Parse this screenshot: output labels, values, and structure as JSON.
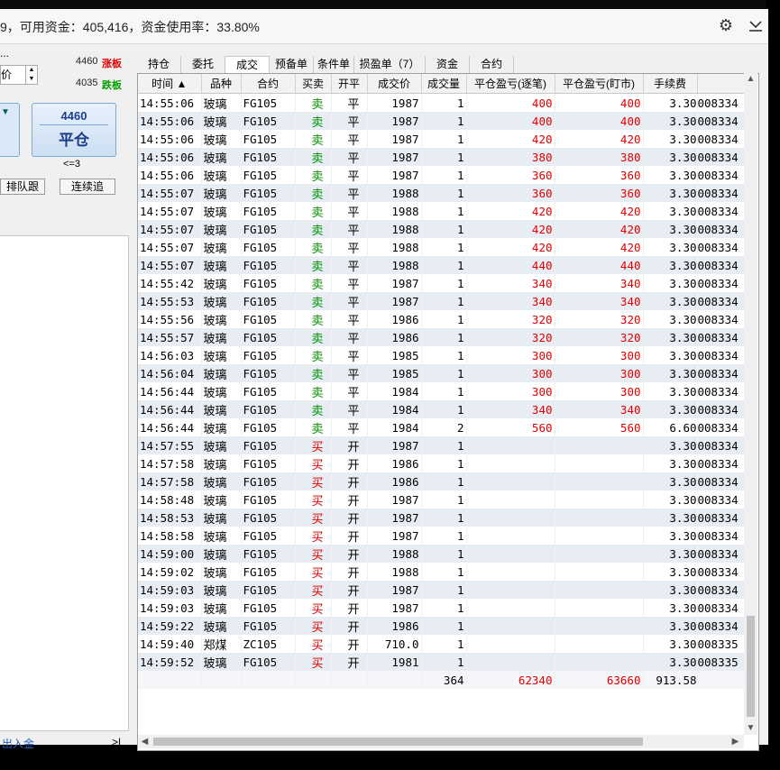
{
  "window": {
    "title": "9，可用资金：405,416，资金使用率：33.80%",
    "gear_icon": "gear-icon",
    "minimize_icon": "chevron-down-icon"
  },
  "left_panel": {
    "ellipsis": "...",
    "price_type": "价",
    "up_limit_price": "4460",
    "up_limit_label": "涨板",
    "down_limit_price": "4035",
    "down_limit_label": "跌板",
    "close_button_price": "4460",
    "close_button_label": "平仓",
    "condition": "<=3",
    "queue_button": "排队跟",
    "continue_button": "连续追",
    "deposit_link": "出入金",
    "expand_button": ">|"
  },
  "tabs": [
    {
      "label": "持仓"
    },
    {
      "label": "委托"
    },
    {
      "label": "成交"
    },
    {
      "label": "预备单"
    },
    {
      "label": "条件单"
    },
    {
      "label": "损盈单（7）"
    },
    {
      "label": "资金"
    },
    {
      "label": "合约"
    }
  ],
  "active_tab": "成交",
  "columns": [
    "时间 ▲",
    "品种",
    "合约",
    "买卖",
    "开平",
    "成交价",
    "成交量",
    "平仓盈亏(逐笔)",
    "平仓盈亏(盯市)",
    "手续费",
    ""
  ],
  "rows": [
    [
      "14:55:06",
      "玻璃",
      "FG105",
      "卖",
      "平",
      "1987",
      "1",
      "400",
      "400",
      "3.30",
      "008334"
    ],
    [
      "14:55:06",
      "玻璃",
      "FG105",
      "卖",
      "平",
      "1987",
      "1",
      "400",
      "400",
      "3.30",
      "008334"
    ],
    [
      "14:55:06",
      "玻璃",
      "FG105",
      "卖",
      "平",
      "1987",
      "1",
      "420",
      "420",
      "3.30",
      "008334"
    ],
    [
      "14:55:06",
      "玻璃",
      "FG105",
      "卖",
      "平",
      "1987",
      "1",
      "380",
      "380",
      "3.30",
      "008334"
    ],
    [
      "14:55:06",
      "玻璃",
      "FG105",
      "卖",
      "平",
      "1987",
      "1",
      "360",
      "360",
      "3.30",
      "008334"
    ],
    [
      "14:55:07",
      "玻璃",
      "FG105",
      "卖",
      "平",
      "1988",
      "1",
      "360",
      "360",
      "3.30",
      "008334"
    ],
    [
      "14:55:07",
      "玻璃",
      "FG105",
      "卖",
      "平",
      "1988",
      "1",
      "420",
      "420",
      "3.30",
      "008334"
    ],
    [
      "14:55:07",
      "玻璃",
      "FG105",
      "卖",
      "平",
      "1988",
      "1",
      "420",
      "420",
      "3.30",
      "008334"
    ],
    [
      "14:55:07",
      "玻璃",
      "FG105",
      "卖",
      "平",
      "1988",
      "1",
      "420",
      "420",
      "3.30",
      "008334"
    ],
    [
      "14:55:07",
      "玻璃",
      "FG105",
      "卖",
      "平",
      "1988",
      "1",
      "440",
      "440",
      "3.30",
      "008334"
    ],
    [
      "14:55:42",
      "玻璃",
      "FG105",
      "卖",
      "平",
      "1987",
      "1",
      "340",
      "340",
      "3.30",
      "008334"
    ],
    [
      "14:55:53",
      "玻璃",
      "FG105",
      "卖",
      "平",
      "1987",
      "1",
      "340",
      "340",
      "3.30",
      "008334"
    ],
    [
      "14:55:56",
      "玻璃",
      "FG105",
      "卖",
      "平",
      "1986",
      "1",
      "320",
      "320",
      "3.30",
      "008334"
    ],
    [
      "14:55:57",
      "玻璃",
      "FG105",
      "卖",
      "平",
      "1986",
      "1",
      "320",
      "320",
      "3.30",
      "008334"
    ],
    [
      "14:56:03",
      "玻璃",
      "FG105",
      "卖",
      "平",
      "1985",
      "1",
      "300",
      "300",
      "3.30",
      "008334"
    ],
    [
      "14:56:04",
      "玻璃",
      "FG105",
      "卖",
      "平",
      "1985",
      "1",
      "300",
      "300",
      "3.30",
      "008334"
    ],
    [
      "14:56:44",
      "玻璃",
      "FG105",
      "卖",
      "平",
      "1984",
      "1",
      "300",
      "300",
      "3.30",
      "008334"
    ],
    [
      "14:56:44",
      "玻璃",
      "FG105",
      "卖",
      "平",
      "1984",
      "1",
      "340",
      "340",
      "3.30",
      "008334"
    ],
    [
      "14:56:44",
      "玻璃",
      "FG105",
      "卖",
      "平",
      "1984",
      "2",
      "560",
      "560",
      "6.60",
      "008334"
    ],
    [
      "14:57:55",
      "玻璃",
      "FG105",
      "买",
      "开",
      "1987",
      "1",
      "",
      "",
      "3.30",
      "008334"
    ],
    [
      "14:57:58",
      "玻璃",
      "FG105",
      "买",
      "开",
      "1986",
      "1",
      "",
      "",
      "3.30",
      "008334"
    ],
    [
      "14:57:58",
      "玻璃",
      "FG105",
      "买",
      "开",
      "1986",
      "1",
      "",
      "",
      "3.30",
      "008334"
    ],
    [
      "14:58:48",
      "玻璃",
      "FG105",
      "买",
      "开",
      "1987",
      "1",
      "",
      "",
      "3.30",
      "008334"
    ],
    [
      "14:58:53",
      "玻璃",
      "FG105",
      "买",
      "开",
      "1987",
      "1",
      "",
      "",
      "3.30",
      "008334"
    ],
    [
      "14:58:58",
      "玻璃",
      "FG105",
      "买",
      "开",
      "1987",
      "1",
      "",
      "",
      "3.30",
      "008334"
    ],
    [
      "14:59:00",
      "玻璃",
      "FG105",
      "买",
      "开",
      "1988",
      "1",
      "",
      "",
      "3.30",
      "008334"
    ],
    [
      "14:59:02",
      "玻璃",
      "FG105",
      "买",
      "开",
      "1988",
      "1",
      "",
      "",
      "3.30",
      "008334"
    ],
    [
      "14:59:03",
      "玻璃",
      "FG105",
      "买",
      "开",
      "1987",
      "1",
      "",
      "",
      "3.30",
      "008334"
    ],
    [
      "14:59:03",
      "玻璃",
      "FG105",
      "买",
      "开",
      "1987",
      "1",
      "",
      "",
      "3.30",
      "008334"
    ],
    [
      "14:59:22",
      "玻璃",
      "FG105",
      "买",
      "开",
      "1986",
      "1",
      "",
      "",
      "3.30",
      "008334"
    ],
    [
      "14:59:40",
      "郑煤",
      "ZC105",
      "买",
      "开",
      "710.0",
      "1",
      "",
      "",
      "3.30",
      "008335"
    ],
    [
      "14:59:52",
      "玻璃",
      "FG105",
      "买",
      "开",
      "1981",
      "1",
      "",
      "",
      "3.30",
      "008335"
    ]
  ],
  "totals": {
    "volume": "364",
    "pnl_trade": "62340",
    "pnl_mark": "63660",
    "fee": "913.58"
  },
  "colors": {
    "sell": "#009000",
    "buy": "#e00000",
    "pnl": "#e00000",
    "row_alt": "#e8edf3"
  }
}
